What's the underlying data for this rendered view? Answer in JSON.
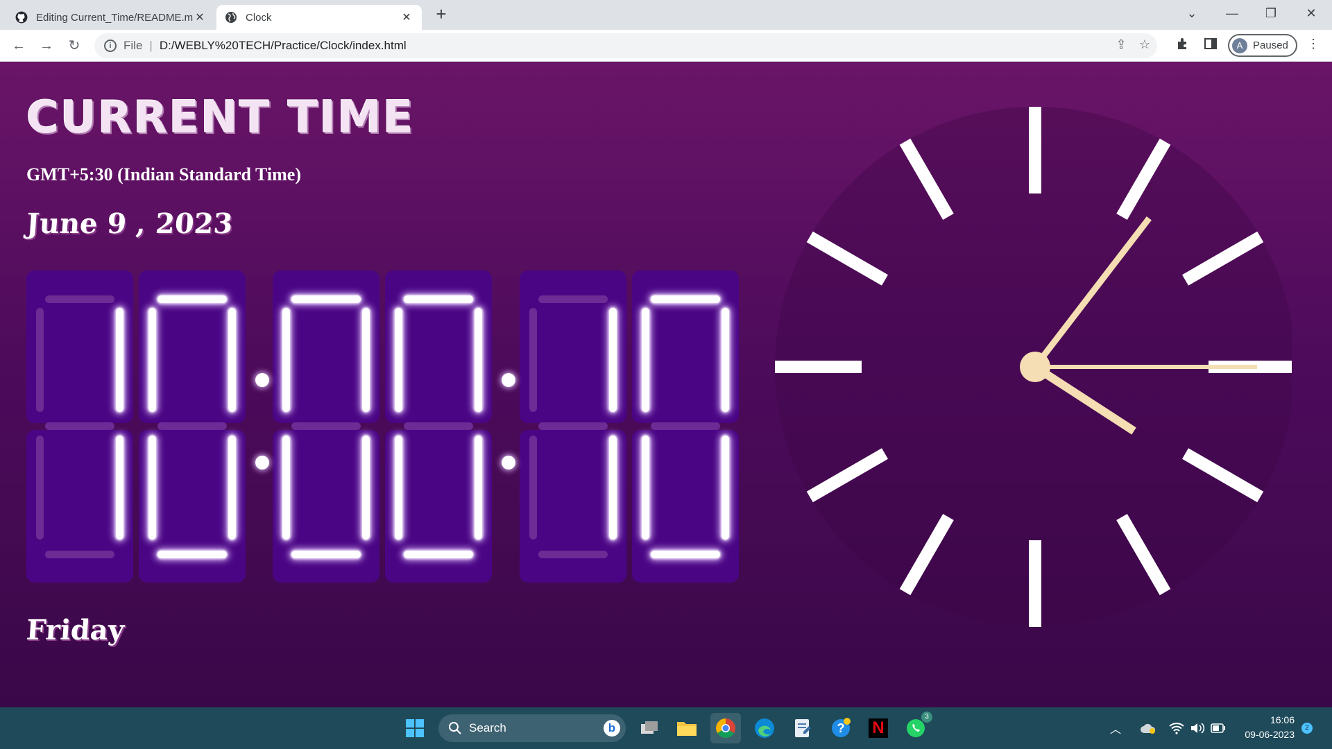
{
  "browser": {
    "tabs": [
      {
        "title": "Editing Current_Time/README.m",
        "icon": "github-icon",
        "active": false
      },
      {
        "title": "Clock",
        "icon": "globe-icon",
        "active": true
      }
    ],
    "address": {
      "scheme": "File",
      "path": "D:/WEBLY%20TECH/Practice/Clock/index.html"
    },
    "profile_status": "Paused",
    "profile_initial": "A"
  },
  "page": {
    "heading": "CURRENT TIME",
    "timezone": "GMT+5:30 (Indian Standard Time)",
    "date": "June 9 , 2023",
    "weekday": "Friday",
    "digital_time": {
      "digits": [
        "1",
        "0",
        "0",
        "0",
        "1",
        "0"
      ]
    },
    "analog_time": {
      "hour": 4,
      "minute": 6,
      "second": 15
    }
  },
  "taskbar": {
    "search_placeholder": "Search",
    "time": "16:06",
    "date": "09-06-2023",
    "notification_count": "2",
    "whatsapp_badge": "3",
    "colors": {
      "bar": "#1f4a5a",
      "accent": "#4cc2ff"
    }
  },
  "colors": {
    "page_top": "#6a1567",
    "page_bottom": "#3a0848",
    "digit_box": "#4a0585",
    "clock_hands": "#f5deb3"
  }
}
